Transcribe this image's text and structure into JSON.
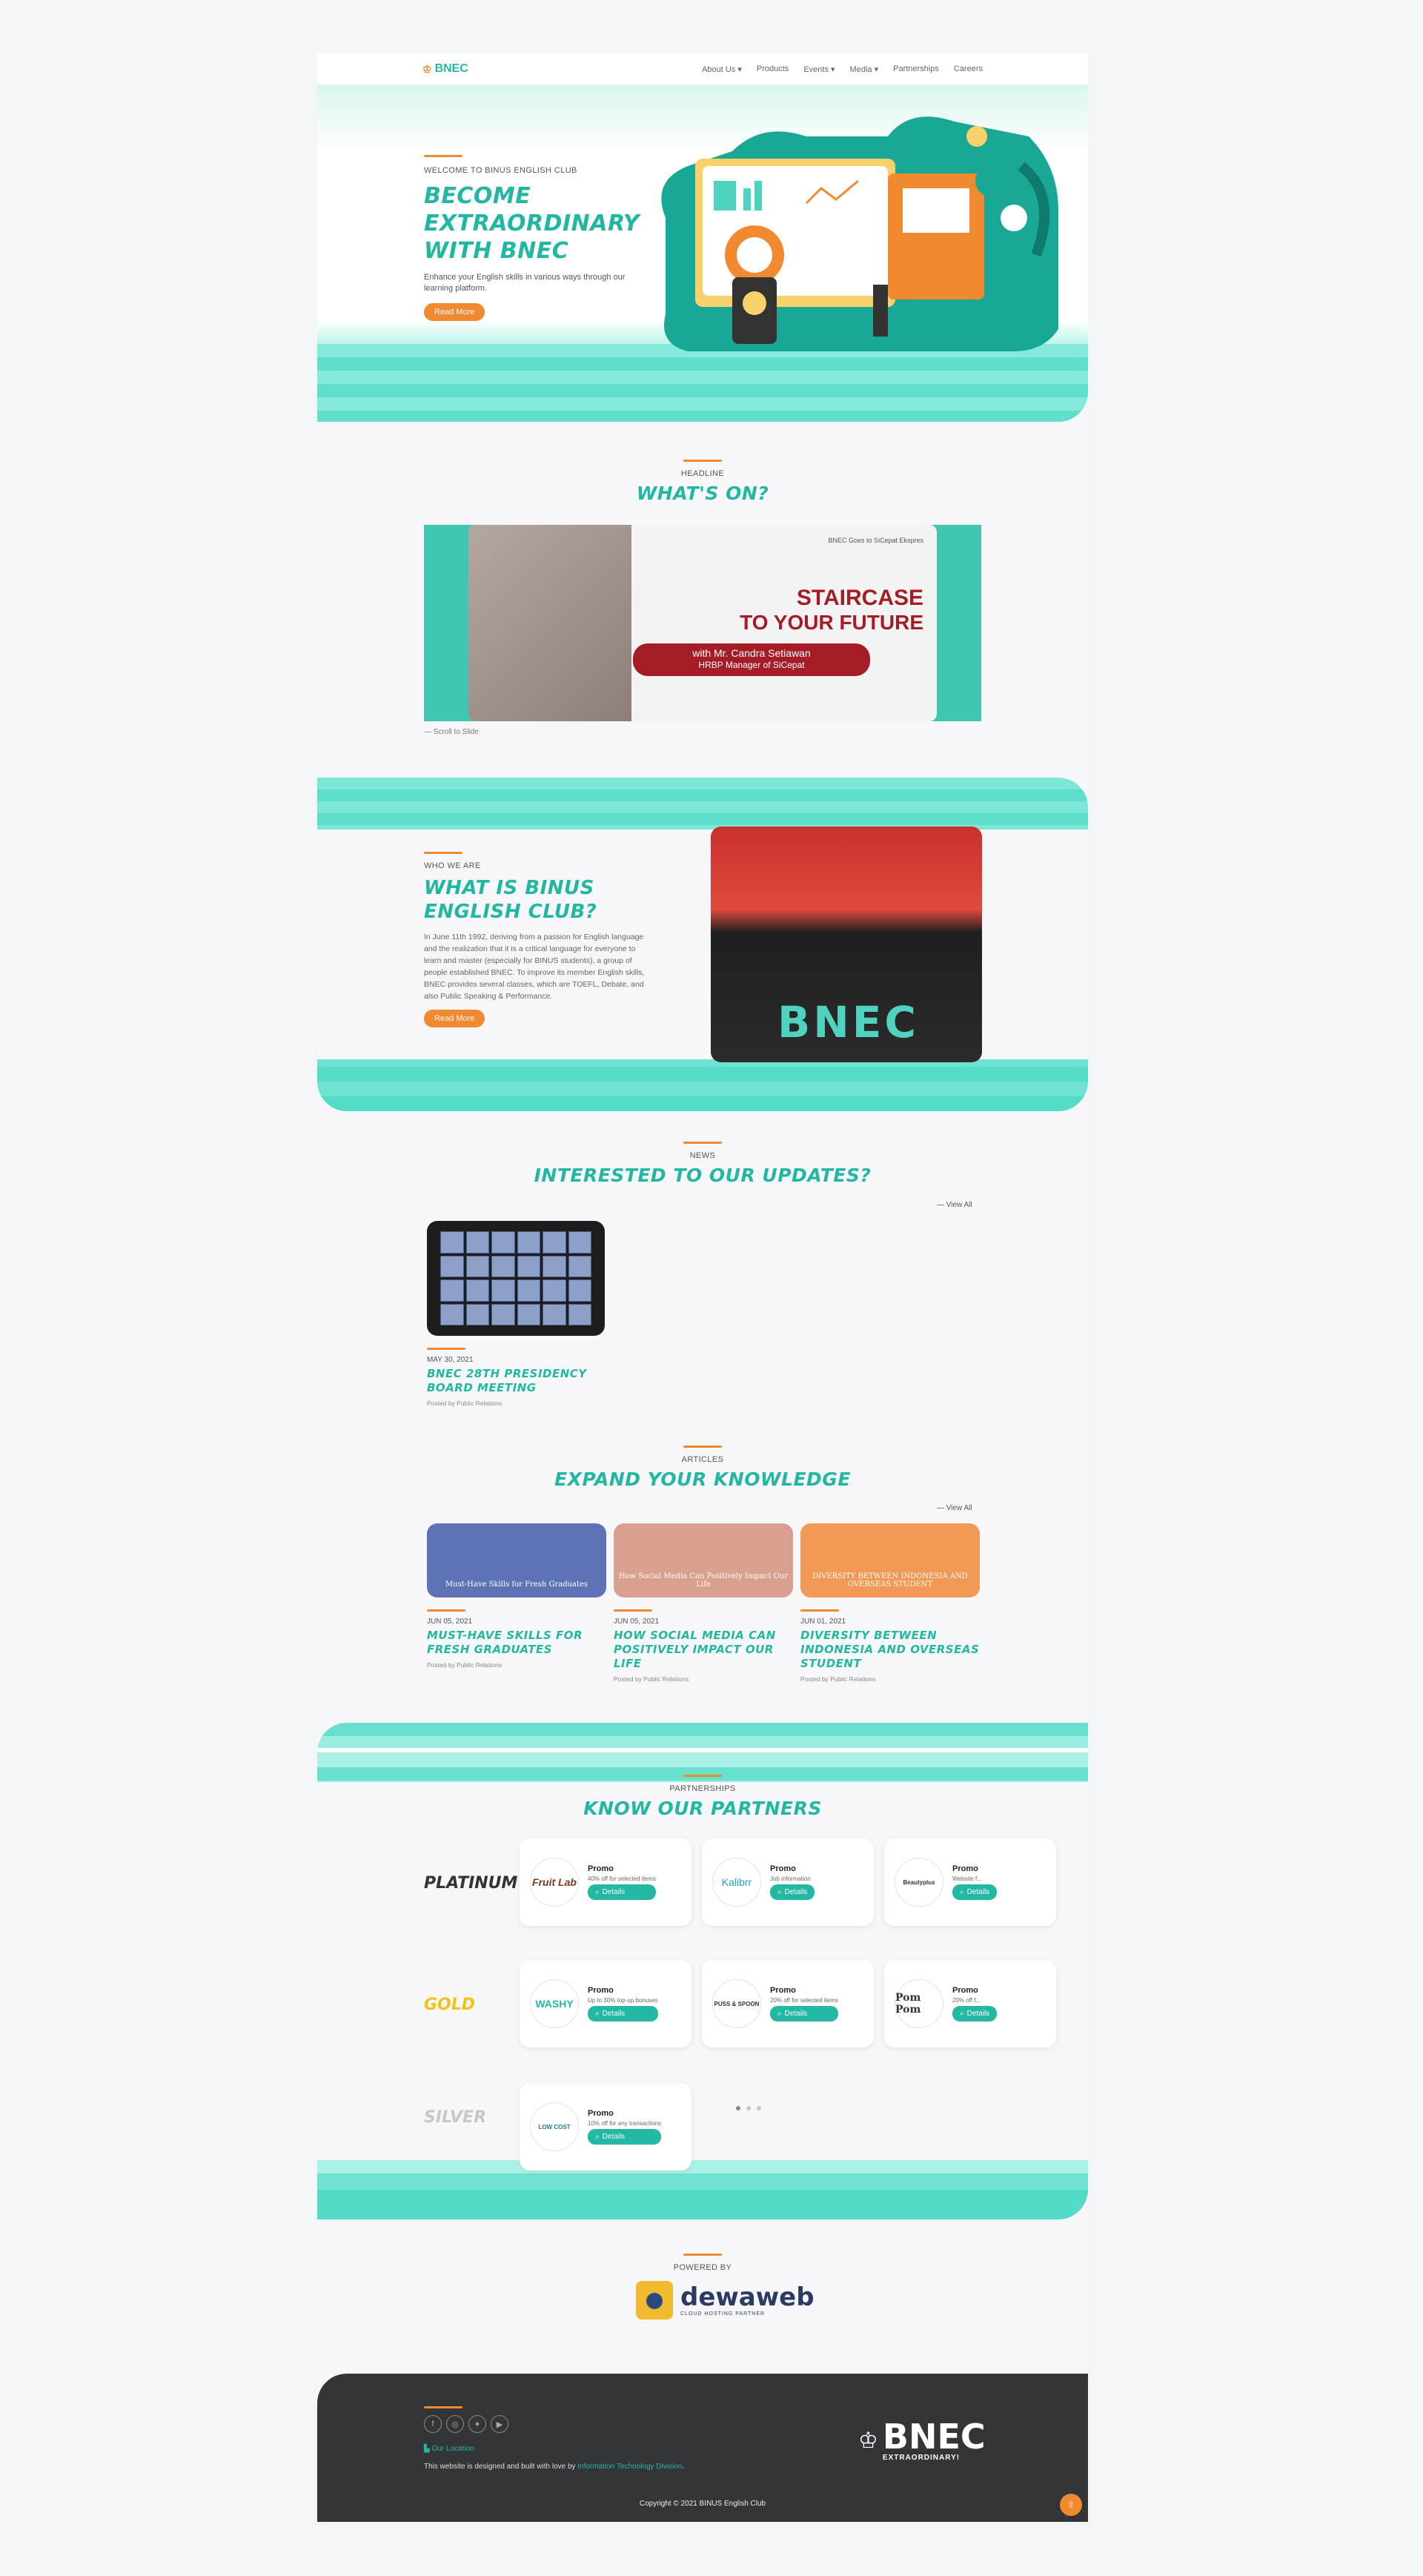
{
  "nav": {
    "logo_text": "BNEC",
    "items": [
      {
        "label": "About Us",
        "caret": "▾"
      },
      {
        "label": "Products",
        "caret": ""
      },
      {
        "label": "Events",
        "caret": "▾"
      },
      {
        "label": "Media",
        "caret": "▾"
      },
      {
        "label": "Partnerships",
        "caret": ""
      },
      {
        "label": "Careers",
        "caret": ""
      }
    ]
  },
  "hero": {
    "kicker": "WELCOME TO BINUS ENGLISH CLUB",
    "title_lines": [
      "BECOME",
      "EXTRAORDINARY",
      "WITH BNEC"
    ],
    "subtitle": "Enhance your English skills in various ways through our learning platform.",
    "button": "Read More"
  },
  "headline": {
    "kicker": "HEADLINE",
    "title": "WHAT'S ON?",
    "slide": {
      "brand_line": "BNEC Goes to SiCepat Ekspres",
      "title_line1": "STAIRCASE",
      "title_line2": "TO YOUR FUTURE",
      "speaker": "with Mr. Candra Setiawan",
      "speaker_role": "HRBP Manager of SiCepat"
    },
    "scroll_hint": "— Scroll to Slide"
  },
  "who": {
    "kicker": "WHO WE ARE",
    "title_lines": [
      "WHAT IS BINUS",
      "ENGLISH CLUB?"
    ],
    "body": "In June 11th 1992, deriving from a passion for English language and the realization that it is a critical language for everyone to learn and master (especially for BINUS students), a group of people established BNEC. To improve its member English skills, BNEC provides several classes, which are TOEFL, Debate, and also Public Speaking & Performance.",
    "button": "Read More",
    "photo_text": "BNEC"
  },
  "news": {
    "kicker": "NEWS",
    "title": "INTERESTED TO OUR UPDATES?",
    "view_all": "— View All",
    "post": {
      "date": "MAY 30, 2021",
      "title": "BNEC 28TH PRESIDENCY BOARD MEETING",
      "by": "Posted by Public Relations"
    }
  },
  "articles": {
    "kicker": "ARTICLES",
    "title": "EXPAND YOUR KNOWLEDGE",
    "view_all": "— View All",
    "posts": [
      {
        "date": "JUN 05, 2021",
        "title": "MUST-HAVE SKILLS FOR FRESH GRADUATES",
        "by": "Posted by Public Relations",
        "img_text": "Must-Have Skills for Fresh Graduates",
        "color": "#5d73b5"
      },
      {
        "date": "JUN 05, 2021",
        "title": "HOW SOCIAL MEDIA CAN POSITIVELY IMPACT OUR LIFE",
        "by": "Posted by Public Relations",
        "img_text": "How Social Media Can Positively Impact Our Life",
        "color": "#d9a08f"
      },
      {
        "date": "JUN 01, 2021",
        "title": "DIVERSITY BETWEEN INDONESIA AND OVERSEAS STUDENT",
        "by": "Posted by Public Relations",
        "img_text": "DIVERSITY BETWEEN INDONESIA AND OVERSEAS STUDENT",
        "color": "#f29a55"
      }
    ]
  },
  "partners": {
    "kicker": "PARTNERSHIPS",
    "title": "KNOW OUR PARTNERS",
    "details_label": "Details",
    "platinum": {
      "label": "PLATINUM",
      "color": "#333333",
      "cards": [
        {
          "logo": "Fruit Lab",
          "title": "Promo",
          "desc": "40% off for selected items"
        },
        {
          "logo": "Kalibrr",
          "title": "Promo",
          "desc": "Job information"
        },
        {
          "logo": "Beautyplus",
          "title": "Promo",
          "desc": "Website f..."
        }
      ]
    },
    "gold": {
      "label": "GOLD",
      "color": "#f2c21b",
      "cards": [
        {
          "logo": "WASHY",
          "title": "Promo",
          "desc": "Up to 30% top-up bonuses"
        },
        {
          "logo": "PUSS & SPOON",
          "title": "Promo",
          "desc": "20% off for selected items"
        },
        {
          "logo": "Pom Pom",
          "title": "Promo",
          "desc": "20% off f..."
        }
      ]
    },
    "silver": {
      "label": "SILVER",
      "color": "#c7c7c7",
      "cards": [
        {
          "logo": "LOW COST",
          "title": "Promo",
          "desc": "10% off for any transactions"
        }
      ]
    }
  },
  "powered": {
    "kicker": "POWERED BY",
    "name": "dewaweb",
    "tagline": "CLOUD HOSTING PARTNER"
  },
  "footer": {
    "location": "Our Location",
    "made_prefix": "This website is designed and built with love by ",
    "made_link": "Information Technology Division",
    "made_suffix": ".",
    "logo_big": "BNEC",
    "logo_small": "EXTRAORDINARY!",
    "copyright": "Copyright © 2021 BINUS English Club",
    "socials": [
      "f",
      "◎",
      "✦",
      "▶"
    ]
  },
  "colors": {
    "teal": "#23b8a3",
    "orange": "#f0892f",
    "footer_bg": "#333539"
  }
}
